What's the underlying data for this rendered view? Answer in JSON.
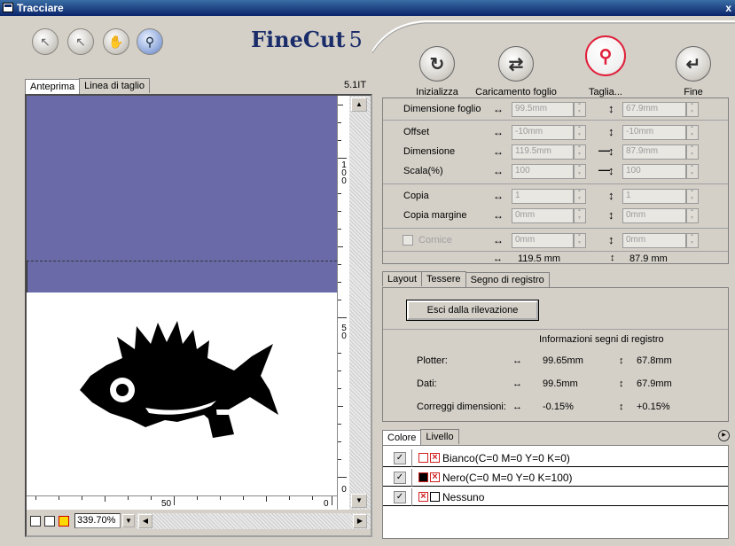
{
  "window": {
    "title": "Tracciare",
    "close": "x"
  },
  "toolbar": {
    "logo_main": "FineCut",
    "logo_version": "5",
    "tools": [
      "select-arrow",
      "direct-select-arrow",
      "hand",
      "zoom"
    ],
    "actions": [
      {
        "label": "Inizializza",
        "icon": "refresh-icon",
        "glyph": "↻"
      },
      {
        "label": "Caricamento foglio",
        "icon": "feed-sheet-icon",
        "glyph": "⇄"
      },
      {
        "label": "Taglia...",
        "icon": "cut-icon",
        "glyph": "⚲"
      },
      {
        "label": "Fine",
        "icon": "return-icon",
        "glyph": "↵"
      }
    ]
  },
  "preview": {
    "tabs": [
      "Anteprima",
      "Linea di taglio"
    ],
    "active_tab": "Anteprima",
    "scale_label": "5.1IT",
    "ruler_v_labels": [
      "1\n0\n0",
      "5\n0",
      "0"
    ],
    "ruler_h_labels": [
      "50",
      "0"
    ],
    "zoom": "339.70%"
  },
  "settings": {
    "dimensione_foglio": {
      "label": "Dimensione foglio",
      "h": "99.5mm",
      "v": "67.9mm"
    },
    "offset": {
      "label": "Offset",
      "h": "-10mm",
      "v": "-10mm"
    },
    "dimensione": {
      "label": "Dimensione",
      "h": "119.5mm",
      "v": "87.9mm"
    },
    "scala": {
      "label": "Scala(%)",
      "h": "100",
      "v": "100"
    },
    "copia": {
      "label": "Copia",
      "h": "1",
      "v": "1"
    },
    "copia_margine": {
      "label": "Copia margine",
      "h": "0mm",
      "v": "0mm"
    },
    "cornice": {
      "label": "Cornice",
      "h": "0mm",
      "v": "0mm"
    },
    "totals": {
      "h": "119.5 mm",
      "v": "87.9 mm"
    }
  },
  "reg_tabs": [
    "Layout",
    "Tessere",
    "Segno di registro"
  ],
  "registration": {
    "exit_button": "Esci dalla rilevazione",
    "title": "Informazioni segni di registro",
    "rows": [
      {
        "label": "Plotter:",
        "h": "99.65mm",
        "v": "67.8mm"
      },
      {
        "label": "Dati:",
        "h": "99.5mm",
        "v": "67.9mm"
      },
      {
        "label": "Correggi dimensioni:",
        "h": "-0.15%",
        "v": "+0.15%"
      }
    ]
  },
  "layer_tabs": [
    "Colore",
    "Livello"
  ],
  "layers": [
    {
      "name": "Bianco(C=0 M=0 Y=0 K=0)",
      "fill": "#ffffff"
    },
    {
      "name": "Nero(C=0 M=0 Y=0 K=100)",
      "fill": "#000000"
    },
    {
      "name": "Nessuno",
      "fill": "none"
    }
  ],
  "colors": {
    "title_bar": "#0a246a",
    "preview_blue": "#6a6aa8",
    "cut_red": "#e0203a"
  }
}
